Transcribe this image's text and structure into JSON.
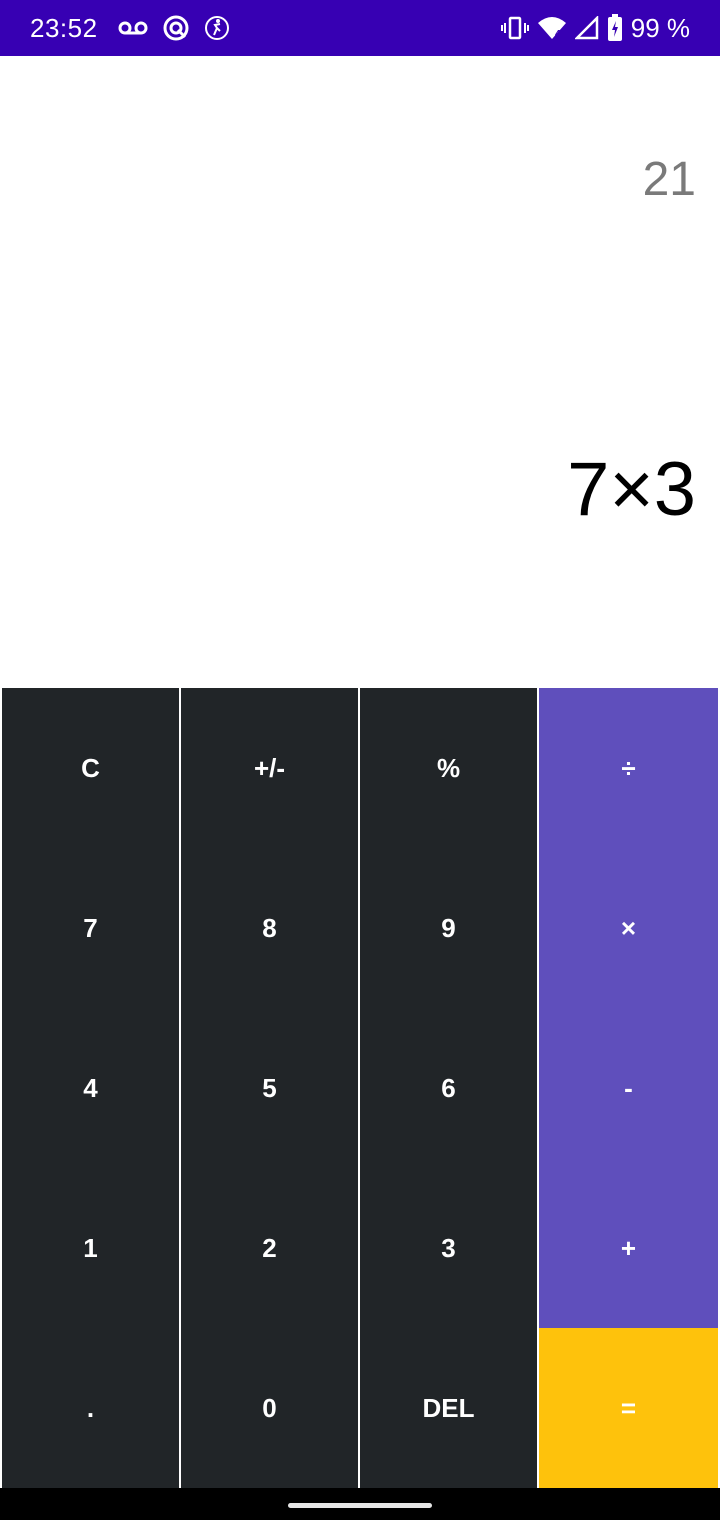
{
  "status_bar": {
    "time": "23:52",
    "battery": "99 %",
    "icons": [
      "voicemail-icon",
      "data-saver-icon",
      "activity-icon",
      "vibrate-icon",
      "wifi-icon",
      "signal-icon",
      "battery-icon"
    ],
    "color": "#3700b3"
  },
  "display": {
    "result": "21",
    "expression": "7×3"
  },
  "keypad": {
    "rows": [
      [
        {
          "label": "C"
        },
        {
          "label": "+/-"
        },
        {
          "label": "%"
        },
        {
          "label": "÷"
        }
      ],
      [
        {
          "label": "7"
        },
        {
          "label": "8"
        },
        {
          "label": "9"
        },
        {
          "label": "×"
        }
      ],
      [
        {
          "label": "4"
        },
        {
          "label": "5"
        },
        {
          "label": "6"
        },
        {
          "label": "-"
        }
      ],
      [
        {
          "label": "1"
        },
        {
          "label": "2"
        },
        {
          "label": "3"
        },
        {
          "label": "+"
        }
      ],
      [
        {
          "label": "."
        },
        {
          "label": "0"
        },
        {
          "label": "DEL"
        },
        {
          "label": "="
        }
      ]
    ],
    "colors": {
      "number_key": "#212528",
      "operator_key": "#5f4fbc",
      "equals_key": "#fec20c"
    }
  }
}
